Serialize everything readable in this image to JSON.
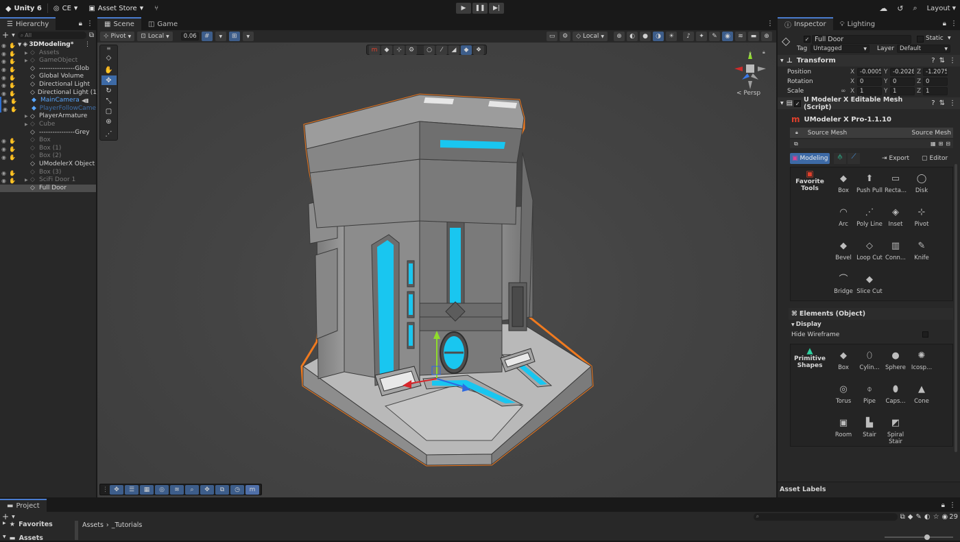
{
  "topbar": {
    "app_label": "Unity 6",
    "account_label": "CE",
    "asset_store_label": "Asset Store",
    "layout_label": "Layout"
  },
  "hierarchy": {
    "tab_label": "Hierarchy",
    "search_placeholder": "All",
    "scene_name": "3DModeling*",
    "items": [
      {
        "label": "Assets",
        "style": "dim"
      },
      {
        "label": "GameObject",
        "style": "dim"
      },
      {
        "label": "----------------Glob",
        "style": "normal"
      },
      {
        "label": "Global Volume",
        "style": "normal"
      },
      {
        "label": "Directional Light",
        "style": "normal"
      },
      {
        "label": "Directional Light (1)",
        "style": "normal"
      },
      {
        "label": "MainCamera",
        "style": "blue"
      },
      {
        "label": "PlayerFollowCame",
        "style": "blue-dim"
      },
      {
        "label": "PlayerArmature",
        "style": "normal"
      },
      {
        "label": "Cube",
        "style": "dim"
      },
      {
        "label": "----------------Grey",
        "style": "normal"
      },
      {
        "label": "Box",
        "style": "dim"
      },
      {
        "label": "Box (1)",
        "style": "dim"
      },
      {
        "label": "Box (2)",
        "style": "dim"
      },
      {
        "label": "UModelerX Object",
        "style": "normal"
      },
      {
        "label": "Box (3)",
        "style": "dim"
      },
      {
        "label": "SciFi Door 1",
        "style": "dim"
      },
      {
        "label": "Full Door",
        "style": "selected"
      }
    ]
  },
  "scene": {
    "tabs": [
      {
        "label": "Scene"
      },
      {
        "label": "Game"
      }
    ],
    "pivot_label": "Pivot",
    "local_label": "Local",
    "snap_value": "0.06",
    "local2_label": "Local",
    "persp_label": "< Persp"
  },
  "inspector": {
    "tabs": [
      {
        "label": "Inspector"
      },
      {
        "label": "Lighting"
      }
    ],
    "object_name": "Full Door",
    "static_label": "Static",
    "tag_label": "Tag",
    "tag_value": "Untagged",
    "layer_label": "Layer",
    "layer_value": "Default",
    "transform": {
      "title": "Transform",
      "position_label": "Position",
      "rotation_label": "Rotation",
      "scale_label": "Scale",
      "position": {
        "x": "-0.0005",
        "y": "-0.2028",
        "z": "-1.20756"
      },
      "rotation": {
        "x": "0",
        "y": "0",
        "z": "0"
      },
      "scale": {
        "x": "1",
        "y": "1",
        "z": "1"
      }
    },
    "script_title": "U Modeler X Editable Mesh (Script)",
    "umodeler_version": "UModeler X Pro-1.1.10",
    "source_mesh_label": "Source Mesh",
    "source_mesh_value": "Source Mesh",
    "modeling_tab": "Modeling",
    "export_label": "Export",
    "editor_label": "Editor",
    "favorite_tools_label": "Favorite Tools",
    "favorite_tools": [
      {
        "label": "Box",
        "icon": "box-icon"
      },
      {
        "label": "Push Pull",
        "icon": "pushpull-icon"
      },
      {
        "label": "Recta...",
        "icon": "rectangle-icon"
      },
      {
        "label": "Disk",
        "icon": "disk-icon"
      },
      {
        "label": "Arc",
        "icon": "arc-icon"
      },
      {
        "label": "Poly Line",
        "icon": "polyline-icon"
      },
      {
        "label": "Inset",
        "icon": "inset-icon"
      },
      {
        "label": "Pivot",
        "icon": "pivot-icon"
      },
      {
        "label": "Bevel",
        "icon": "bevel-icon"
      },
      {
        "label": "Loop Cut",
        "icon": "loopcut-icon"
      },
      {
        "label": "Conn...",
        "icon": "connect-icon"
      },
      {
        "label": "Knife",
        "icon": "knife-icon"
      },
      {
        "label": "Bridge",
        "icon": "bridge-icon"
      },
      {
        "label": "Slice Cut",
        "icon": "slicecut-icon"
      }
    ],
    "elements_label": "Elements (Object)",
    "display_label": "Display",
    "hide_wireframe_label": "Hide Wireframe",
    "primitive_shapes_label": "Primitive Shapes",
    "primitives": [
      {
        "label": "Box",
        "icon": "box-icon"
      },
      {
        "label": "Cylin...",
        "icon": "cylinder-icon"
      },
      {
        "label": "Sphere",
        "icon": "sphere-icon"
      },
      {
        "label": "Icosp...",
        "icon": "icosphere-icon"
      },
      {
        "label": "Torus",
        "icon": "torus-icon"
      },
      {
        "label": "Pipe",
        "icon": "pipe-icon"
      },
      {
        "label": "Caps...",
        "icon": "capsule-icon"
      },
      {
        "label": "Cone",
        "icon": "cone-icon"
      },
      {
        "label": "Room",
        "icon": "room-icon"
      },
      {
        "label": "Stair",
        "icon": "stair-icon"
      },
      {
        "label": "Spiral Stair",
        "icon": "spiralstair-icon"
      }
    ],
    "asset_labels": "Asset Labels"
  },
  "project": {
    "tab_label": "Project",
    "favorites_label": "Favorites",
    "assets_label": "Assets",
    "breadcrumb": [
      "Assets",
      "_Tutorials"
    ],
    "count": "29"
  },
  "colors": {
    "accent": "#4a7ccf",
    "selection_outline": "#f07a1f",
    "neon": "#19c6f0"
  }
}
